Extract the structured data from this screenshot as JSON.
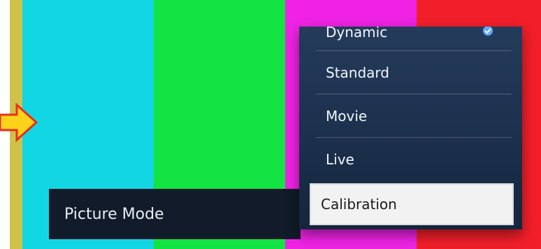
{
  "colors": {
    "yellow_bar": "#cfc24a",
    "cyan_bar": "#12d6e3",
    "green_bar": "#13e443",
    "magenta_bar": "#f023e5",
    "red_bar": "#f21f2a",
    "arrow_fill": "#ffd21a",
    "arrow_outline": "#e7301f",
    "menu_bg": "#1b2f4b"
  },
  "menu": {
    "items": [
      {
        "label": "Dynamic",
        "selected_check": true
      },
      {
        "label": "Standard"
      },
      {
        "label": "Movie"
      },
      {
        "label": "Live"
      },
      {
        "label": "Calibration",
        "highlighted": true
      }
    ]
  },
  "setting": {
    "label": "Picture Mode"
  },
  "icons": {
    "check": "check-icon",
    "pointer": "arrow-pointer-icon"
  }
}
